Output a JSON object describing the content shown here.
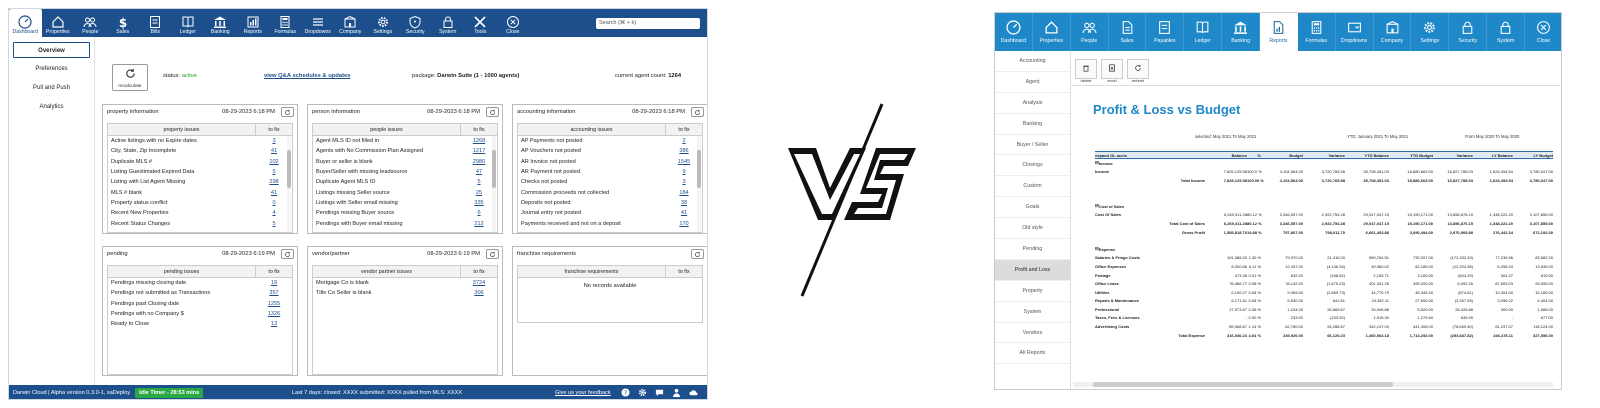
{
  "left_app": {
    "nav": [
      {
        "label": "Dashboard",
        "icon": "gauge-icon",
        "active": true
      },
      {
        "label": "Properties",
        "icon": "home-icon"
      },
      {
        "label": "People",
        "icon": "people-icon"
      },
      {
        "label": "Sales",
        "icon": "dollar-icon"
      },
      {
        "label": "Bills",
        "icon": "bill-icon"
      },
      {
        "label": "Ledger",
        "icon": "book-icon"
      },
      {
        "label": "Banking",
        "icon": "bank-icon"
      },
      {
        "label": "Reports",
        "icon": "chart-icon"
      },
      {
        "label": "Formulas",
        "icon": "calculator-icon"
      },
      {
        "label": "Dropdowns",
        "icon": "list-icon"
      },
      {
        "label": "Company",
        "icon": "building-icon"
      },
      {
        "label": "Settings",
        "icon": "gear-icon"
      },
      {
        "label": "Security",
        "icon": "shield-icon"
      },
      {
        "label": "System",
        "icon": "lock-icon"
      },
      {
        "label": "Tools",
        "icon": "tools-icon"
      },
      {
        "label": "Close",
        "icon": "close-icon"
      }
    ],
    "search_placeholder": "Search (⌘ + k)",
    "sidebar": [
      "Overview",
      "Preferences",
      "Pull and Push",
      "Analytics"
    ],
    "recalc_label": "recalculate",
    "status_label": "status:",
    "status_value": "active",
    "qa_link": "view Q&A schedules & updates",
    "package_label": "package:",
    "package_value": "Darwin Suite (1 - 1000 agents)",
    "agent_count_label": "current agent count:",
    "agent_count_value": "1264",
    "panels": [
      {
        "title": "property information",
        "date": "08-29-2023 6:18 PM",
        "col1": "property issues",
        "col2": "to fix",
        "rows": [
          [
            "Active listings with no Expire dates",
            "3"
          ],
          [
            "City, State, Zip Incomplete",
            "41"
          ],
          [
            "Duplicate MLS #",
            "102"
          ],
          [
            "Listing Guestimated Expired Data",
            "5"
          ],
          [
            "Listing with List Agent Missing",
            "298"
          ],
          [
            "MLS # blank",
            "41"
          ],
          [
            "Property status conflict",
            "0"
          ],
          [
            "Recent New Properties",
            "4"
          ],
          [
            "Recent Status Changes",
            "5"
          ]
        ]
      },
      {
        "title": "person information",
        "date": "08-29-2023 6:18 PM",
        "col1": "people issues",
        "col2": "to fix",
        "rows": [
          [
            "Agent MLS ID not filled in",
            "1268"
          ],
          [
            "Agents with No Commission Plan Assigned",
            "1217"
          ],
          [
            "Buyer or seller is blank",
            "2980"
          ],
          [
            "Buyer/Seller with missing leadsource",
            "47"
          ],
          [
            "Duplicate Agent MLS ID",
            "5"
          ],
          [
            "Listings missing Seller source",
            "25"
          ],
          [
            "Listings with Seller email missing",
            "335"
          ],
          [
            "Pendings missing Buyer source",
            "6"
          ],
          [
            "Pendings with Buyer email missing",
            "212"
          ]
        ]
      },
      {
        "title": "accounting information",
        "date": "08-29-2023 6:18 PM",
        "col1": "accounting issues",
        "col2": "to fix",
        "rows": [
          [
            "AP Payments not posted",
            "2"
          ],
          [
            "AP Vouchers not posted",
            "386"
          ],
          [
            "AR Invoice not posted",
            "1545"
          ],
          [
            "AR Payment not posted",
            "9"
          ],
          [
            "Checks not posted",
            "3"
          ],
          [
            "Commission proceeds not collected",
            "184"
          ],
          [
            "Deposits not posted",
            "38"
          ],
          [
            "Journal entry not posted",
            "41"
          ],
          [
            "Payments received and not on a deposit",
            "170"
          ]
        ]
      },
      {
        "title": "pending",
        "date": "08-29-2023 6:19 PM",
        "col1": "pending issues",
        "col2": "to fix",
        "rows": [
          [
            "Pendings missing closing date",
            "19"
          ],
          [
            "Pendings not submitted as Transactions",
            "357"
          ],
          [
            "Pendings past Closing date",
            "1255"
          ],
          [
            "Pendings with no Company $",
            "1326"
          ],
          [
            "Ready to Close",
            "13"
          ]
        ]
      },
      {
        "title": "vendor/partner",
        "date": "08-29-2023 6:19 PM",
        "col1": "vendor partner issues",
        "col2": "to fix",
        "rows": [
          [
            "Mortgage Co is blank",
            "3724"
          ],
          [
            "Title Co Seller is blank",
            "306"
          ]
        ]
      },
      {
        "title": "franchise requirements",
        "date": "",
        "col1": "franchise requirements",
        "col2": "to fix",
        "rows": [],
        "empty": "No records available"
      }
    ],
    "footer": {
      "version": "Darwin Cloud | Alpha version 0.3.0-1, saDeploy",
      "idle": "Idle Timer - 28:53 mins",
      "stats": "Last 7 days: closed: XXXX submitted: XXXX pulled from MLS: XXXX",
      "feedback": "Give us your feedback"
    }
  },
  "vs_label": "VS",
  "right_app": {
    "nav": [
      {
        "label": "Dashboard",
        "icon": "gauge-icon"
      },
      {
        "label": "Properties",
        "icon": "home-icon"
      },
      {
        "label": "People",
        "icon": "people-icon"
      },
      {
        "label": "Sales",
        "icon": "doc-icon"
      },
      {
        "label": "Payables",
        "icon": "bill-icon"
      },
      {
        "label": "Ledger",
        "icon": "book-icon"
      },
      {
        "label": "Banking",
        "icon": "bank-icon"
      },
      {
        "label": "Reports",
        "icon": "report-icon",
        "active": true
      },
      {
        "label": "Formulas",
        "icon": "calculator-icon"
      },
      {
        "label": "Dropdowns",
        "icon": "dropdown-icon"
      },
      {
        "label": "Company",
        "icon": "building-icon"
      },
      {
        "label": "Settings",
        "icon": "gear-icon"
      },
      {
        "label": "Security",
        "icon": "lock-icon"
      },
      {
        "label": "System",
        "icon": "lock-icon"
      },
      {
        "label": "Close",
        "icon": "close-icon"
      }
    ],
    "sidebar": [
      "Accounting",
      "Agent",
      "Analysis",
      "Banking",
      "Buyer / Seller",
      "Closings",
      "Custom",
      "Goals",
      "Old style",
      "Pending",
      "Profit and Loss",
      "Property",
      "System",
      "Vendors",
      "All Reports"
    ],
    "sidebar_active": "Profit and Loss",
    "toolbar": [
      {
        "label": "delete",
        "icon": "trash-icon"
      },
      {
        "label": "excel",
        "icon": "excel-icon"
      },
      {
        "label": "refresh",
        "icon": "refresh-icon"
      }
    ],
    "title": "Profit & Loss vs Budget",
    "periods": [
      "selected: May 2021 To May 2021",
      "YTD: January 2021 To May 2021",
      "From May 2020 To May 2020"
    ],
    "columns": [
      "expand GL accts",
      "Balance",
      "%",
      "Budget",
      "Variance",
      "YTD Balance",
      "YTD Budget",
      "Variance",
      "LY Balance",
      "LY Budget"
    ],
    "rows": [
      {
        "type": "sec",
        "n": "Income"
      },
      {
        "type": "row",
        "n": "Income",
        "v": [
          "7,825,129.98",
          "100.0 %",
          "4,104,564.00",
          "3,720,765.98",
          "35,708,451.03",
          "18,880,663.00",
          "16,827,788.03",
          "1,624,494.54",
          "3,780,047.00"
        ]
      },
      {
        "type": "tot",
        "n": "Total Income",
        "v": [
          "7,825,129.98",
          "100.00 %",
          "4,104,564.00",
          "3,720,765.98",
          "35,708,451.03",
          "18,880,663.00",
          "16,827,788.03",
          "1,624,494.54",
          "3,780,047.00"
        ]
      },
      {
        "type": "blank"
      },
      {
        "type": "blank"
      },
      {
        "type": "sec",
        "n": "Cost of Sales"
      },
      {
        "type": "row",
        "n": "Cost Of Sales",
        "v": [
          "6,269,311.28",
          "80.12 %",
          "3,346,557.00",
          "2,922,754.28",
          "29,047,047.15",
          "15,190,171.00",
          "13,856,876.15",
          "1,348,222.20",
          "3,107,855.00"
        ]
      },
      {
        "type": "tot",
        "n": "Total Cost of Sales",
        "v": [
          "6,269,311.28",
          "80.12 %",
          "3,346,557.00",
          "2,922,754.28",
          "29,047,047.15",
          "15,190,171.00",
          "13,856,876.15",
          "1,348,222.20",
          "3,107,855.00"
        ]
      },
      {
        "type": "tot",
        "n": "Gross Profit",
        "v": [
          "1,555,818.70",
          "19.88 %",
          "757,807.00",
          "798,011.70",
          "6,661,403.88",
          "3,690,494.00",
          "2,970,909.88",
          "276,442.34",
          "672,192.00"
        ]
      },
      {
        "type": "blank"
      },
      {
        "type": "sec",
        "n": "Expense"
      },
      {
        "type": "row",
        "n": "Salaries & Fringe Costs",
        "v": [
          "101,386.00",
          "1.30 %",
          "79,970.00",
          "21,416.00",
          "559,764.51",
          "732,097.00",
          "(172,332.49)",
          "77,236.96",
          "83,582.00"
        ]
      },
      {
        "type": "row",
        "n": "Office Expenses",
        "v": [
          "8,300.66",
          "0.11 %",
          "12,437.00",
          "(4,136.34)",
          "49,980.02",
          "62,185.00",
          "(12,204.98)",
          "6,256.43",
          "13,935.00"
        ]
      },
      {
        "type": "row",
        "n": "Postage",
        "v": [
          "473.38",
          "0.01 %",
          "632.00",
          "(158.62)",
          "2,155.71",
          "3,160.00",
          "(604.29)",
          "304.37",
          "810.00"
        ]
      },
      {
        "type": "row",
        "n": "Office Lease",
        "v": [
          "76,466.77",
          "0.98 %",
          "78,142.00",
          "(1,675.23)",
          "401,301.26",
          "395,209.00",
          "6,092.26",
          "87,553.03",
          "93,595.00"
        ]
      },
      {
        "type": "row",
        "n": "Utilities",
        "v": [
          "6,199.27",
          "0.08 %",
          "9,069.00",
          "(2,869.73)",
          "44,770.79",
          "45,345.40",
          "(574.61)",
          "10,304.00",
          "10,189.00"
        ]
      },
      {
        "type": "row",
        "n": "Repairs & Maintenance",
        "v": [
          "6,171.61",
          "0.08 %",
          "5,530.00",
          "641.61",
          "24,382.11",
          "27,650.00",
          "(3,267.89)",
          "3,096.22",
          "4,404.00"
        ]
      },
      {
        "type": "row",
        "n": "Professional",
        "v": [
          "27,973.67",
          "0.36 %",
          "1,104.00",
          "26,869.67",
          "33,946.88",
          "5,520.00",
          "28,426.88",
          "300.00",
          "1,068.00"
        ]
      },
      {
        "type": "row",
        "n": "Taxes, Fees & Licenses",
        "v": [
          "-",
          "0.00 %",
          "233.92",
          "(233.92)",
          "1,915.30",
          "1,279.60",
          "635.90",
          "-",
          "877.00"
        ]
      },
      {
        "type": "row",
        "n": "Advertising Costs",
        "v": [
          "89,068.87",
          "1.14 %",
          "62,780.00",
          "26,288.87",
          "342,147.00",
          "441,306.00",
          "(78,659.40)",
          "61,237.07",
          "118,124.00"
        ]
      },
      {
        "type": "tot",
        "n": "Total Expense",
        "v": [
          "316,040.23",
          "4.04 %",
          "249,920.00",
          "66,120.23",
          "1,460,564.18",
          "1,714,252.00",
          "(253,687.82)",
          "246,478.11",
          "327,556.00"
        ]
      }
    ]
  }
}
